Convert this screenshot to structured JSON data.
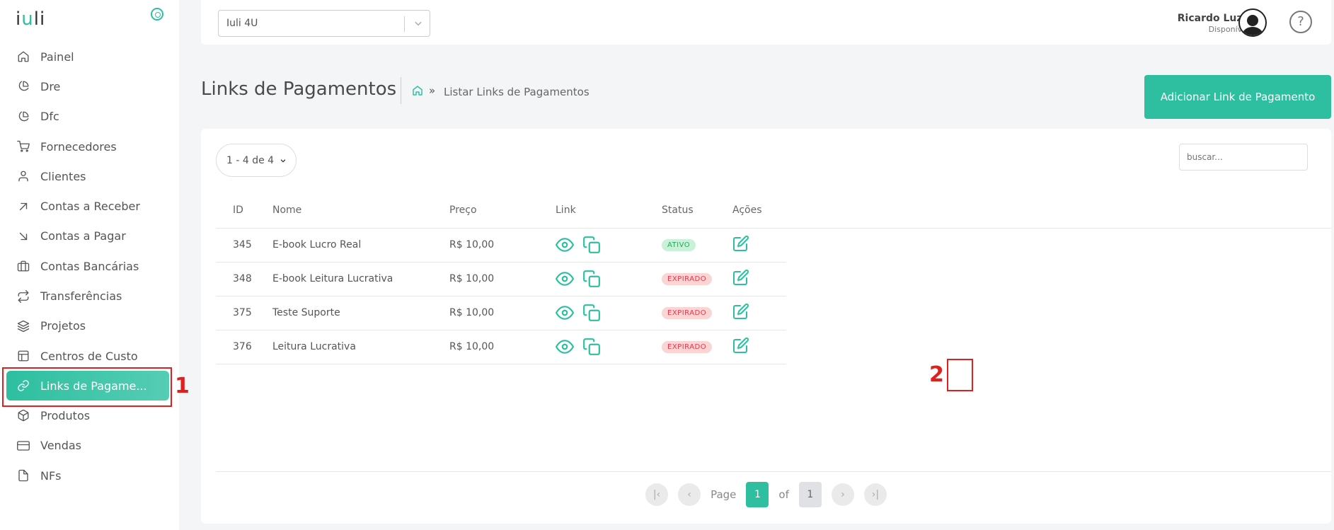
{
  "app": {
    "logo_text": "iuli"
  },
  "sidebar": {
    "items": [
      {
        "label": "Painel",
        "icon": "home-icon"
      },
      {
        "label": "Dre",
        "icon": "pie-chart-icon"
      },
      {
        "label": "Dfc",
        "icon": "pie-chart-icon"
      },
      {
        "label": "Fornecedores",
        "icon": "cart-icon"
      },
      {
        "label": "Clientes",
        "icon": "user-icon"
      },
      {
        "label": "Contas a Receber",
        "icon": "arrow-up-right-icon"
      },
      {
        "label": "Contas a Pagar",
        "icon": "arrow-down-right-icon"
      },
      {
        "label": "Contas Bancárias",
        "icon": "briefcase-icon"
      },
      {
        "label": "Transferências",
        "icon": "repeat-icon"
      },
      {
        "label": "Projetos",
        "icon": "layers-icon"
      },
      {
        "label": "Centros de Custo",
        "icon": "layout-icon"
      },
      {
        "label": "Links de Pagame...",
        "icon": "link-icon",
        "active": true
      },
      {
        "label": "Produtos",
        "icon": "box-icon"
      },
      {
        "label": "Vendas",
        "icon": "credit-card-icon"
      },
      {
        "label": "NFs",
        "icon": "file-icon"
      }
    ]
  },
  "topbar": {
    "company_select": "Iuli 4U",
    "user_name": "Ricardo Luza",
    "user_status": "Disponível",
    "help": "?"
  },
  "page": {
    "title": "Links de Pagamentos",
    "breadcrumb_sep": "»",
    "breadcrumb": "Listar Links de Pagamentos",
    "add_button": "Adicionar Link de Pagamento"
  },
  "table": {
    "range": "1 - 4 de 4",
    "search_placeholder": "buscar...",
    "headers": {
      "id": "ID",
      "nome": "Nome",
      "preco": "Preço",
      "link": "Link",
      "status": "Status",
      "acoes": "Ações"
    },
    "rows": [
      {
        "id": "345",
        "nome": "E-book Lucro Real",
        "preco": "R$ 10,00",
        "status": "ATIVO"
      },
      {
        "id": "348",
        "nome": "E-book Leitura Lucrativa",
        "preco": "R$ 10,00",
        "status": "EXPIRADO"
      },
      {
        "id": "375",
        "nome": "Teste Suporte",
        "preco": "R$ 10,00",
        "status": "EXPIRADO"
      },
      {
        "id": "376",
        "nome": "Leitura Lucrativa",
        "preco": "R$ 10,00",
        "status": "EXPIRADO"
      }
    ]
  },
  "pagination": {
    "page_label": "Page",
    "current": "1",
    "of_label": "of",
    "total": "1"
  },
  "annotations": {
    "one": "1",
    "two": "2"
  },
  "colors": {
    "accent": "#2ebfa0",
    "active_badge": "#27a85b",
    "expired_badge": "#e0394a",
    "annotation": "#e01f1f"
  }
}
